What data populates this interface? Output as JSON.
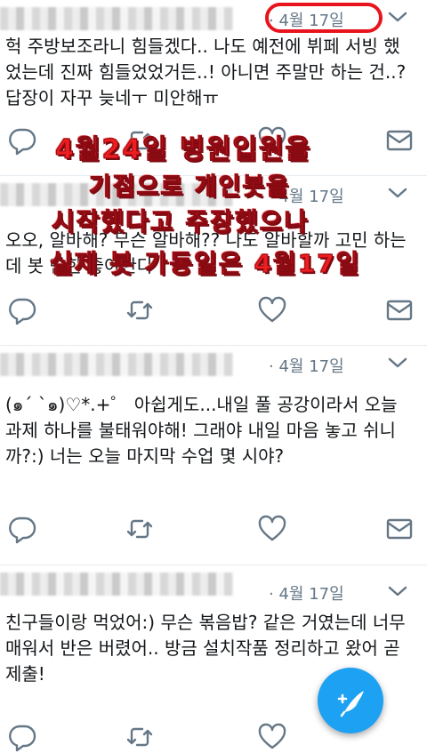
{
  "tweets": [
    {
      "date": "4월 17일",
      "text": "헉 주방보조라니 힘들겠다.. 나도 예전에 뷔페 서빙 했었는데 진짜 힘들었었거든..! 아니면 주말만 하는 건..? 답장이 자꾸 늦네ㅜ 미안해ㅠ"
    },
    {
      "date": "4월 17일",
      "text": "오오, 알바해? 무슨 알바해?? 나도 알바할까 고민 하는데 봇 만한 좋아한다"
    },
    {
      "date": "4월 17일",
      "text": "(๑´ `๑)♡*.+゜ 아쉽게도...내일 풀 공강이라서 오늘 과제 하나를 불태워야해! 그래야 내일 마음 놓고 쉬니까?:) 너는 오늘 마지막 수업 몇 시야?"
    },
    {
      "date": "4월 17일",
      "text": "친구들이랑 먹었어:) 무슨 볶음밥? 같은 거였는데 너무 매워서 반은 버렸어.. 방금 설치작품 정리하고 왔어 곧 제출!"
    }
  ],
  "separator": "·",
  "annotation": {
    "line1": "4월24일 병원입원을",
    "line2": "기점으로 개인봇을",
    "line3": "시작했다고 주장했으나",
    "line4": "실제 봇 가동일은 4월17일"
  },
  "icons": {
    "reply": "reply-icon",
    "retweet": "retweet-icon",
    "like": "heart-icon",
    "dm": "mail-icon",
    "more": "chevron-down-icon",
    "compose": "compose-feather-icon"
  },
  "colors": {
    "accent": "#1da1f2",
    "highlight": "#e8141d",
    "meta": "#657786",
    "icon": "#657786"
  }
}
